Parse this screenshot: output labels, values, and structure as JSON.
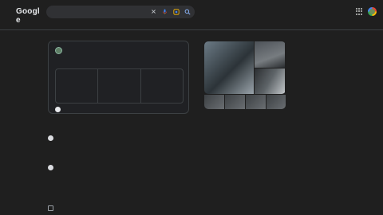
{
  "header": {
    "logo_letters": [
      {
        "char": "G",
        "color": "#e8eaed"
      },
      {
        "char": "o",
        "color": "#e8eaed"
      },
      {
        "char": "o",
        "color": "#e8eaed"
      },
      {
        "char": "g",
        "color": "#e8eaed"
      },
      {
        "char": "l",
        "color": "#e8eaed"
      },
      {
        "char": "e",
        "color": "#e8eaed"
      }
    ],
    "search_value": "",
    "icons": [
      "close-icon",
      "mic-icon",
      "lens-icon",
      "search-icon"
    ],
    "right_icons": [
      "apps-grid-icon",
      "account-avatar"
    ]
  },
  "tabs": [
    {
      "label": "",
      "active": true
    },
    {
      "label": "",
      "active": false
    },
    {
      "label": "",
      "active": false
    },
    {
      "label": "",
      "active": false
    },
    {
      "label": "",
      "active": false
    },
    {
      "label": "",
      "active": false
    }
  ],
  "tools_label": "",
  "safe_search_label": "",
  "stats_text": "",
  "gsc_card": {
    "site_name": "",
    "site_url": "",
    "period": "",
    "metrics": [
      {
        "label": "",
        "value": "",
        "change": "",
        "direction": "up"
      },
      {
        "label": "",
        "value": "",
        "change": "",
        "direction": "down"
      },
      {
        "label": "",
        "value": "",
        "change": "",
        "direction": "down"
      }
    ],
    "cta": ""
  },
  "card_footer_left": "",
  "card_footer_right": "",
  "results": [
    {
      "source_name": "",
      "source_url": "",
      "title": "",
      "snippet": ""
    },
    {
      "source_name": "",
      "source_url": "",
      "title": "",
      "snippet_prefix": "",
      "snippet": ""
    }
  ],
  "images_section_label": "",
  "knowledge_panel": {
    "title": "",
    "description": "",
    "link": ""
  },
  "colors": {
    "background": "#1f1f1f",
    "accent": "#8ab4f8",
    "link": "#99c3ff",
    "positive": "#81c995",
    "negative": "#f28b82"
  }
}
